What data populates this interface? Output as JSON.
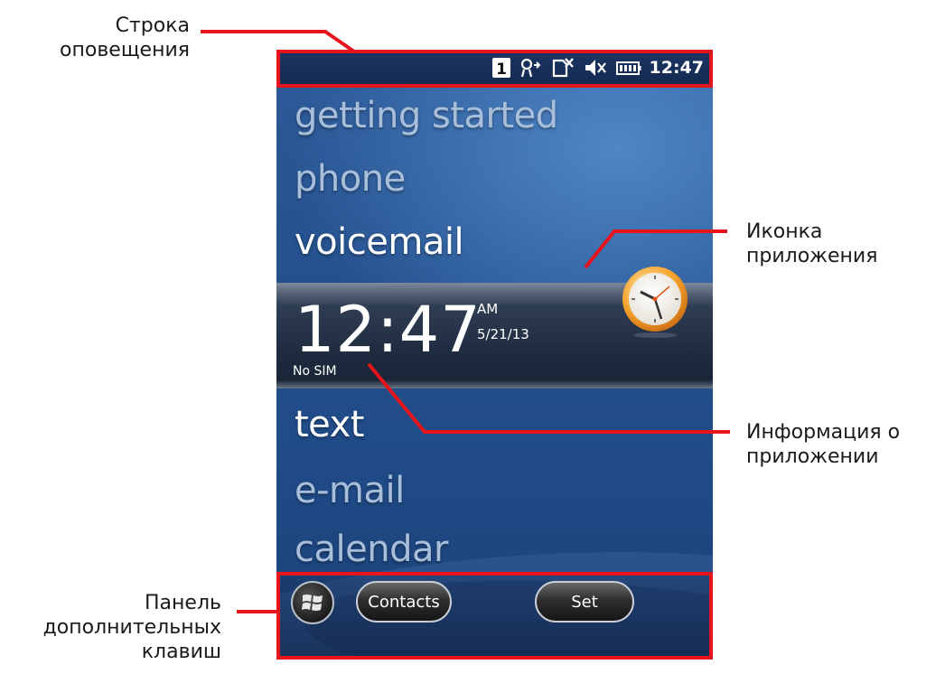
{
  "annotations": {
    "notification_bar": [
      "Строка",
      "оповещения"
    ],
    "app_icon": [
      "Иконка",
      "приложения"
    ],
    "app_info": [
      "Информация о",
      "приложении"
    ],
    "softkey_panel": [
      "Панель",
      "дополнительных",
      "клавиш"
    ]
  },
  "status_bar": {
    "icons": [
      "sim-slot-1-icon",
      "network-roaming-icon",
      "no-sim-icon",
      "speaker-muted-icon",
      "battery-icon"
    ],
    "sim_slot_label": "1",
    "time": "12:47"
  },
  "home_menu": {
    "items_top": [
      "getting started",
      "phone",
      "voicemail"
    ],
    "items_bottom": [
      "text",
      "e-mail",
      "calendar"
    ]
  },
  "clock_panel": {
    "time": "12:47",
    "ampm": "AM",
    "date": "5/21/13",
    "status": "No SIM",
    "icon": "clock-icon"
  },
  "softkey_bar": {
    "start_icon": "windows-start-icon",
    "left_label": "Contacts",
    "right_label": "Set"
  },
  "colors": {
    "callout": "#e8141c",
    "screen_bg": "#24508d",
    "status_bar_bg": "#142a52",
    "menu_dim": "#a9bfd9",
    "menu_bright": "#ffffff"
  }
}
